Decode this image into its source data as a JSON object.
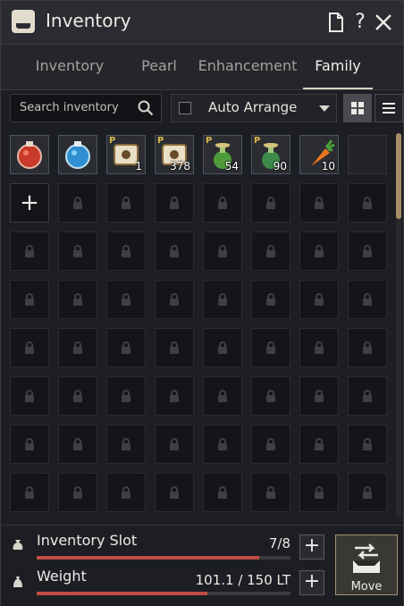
{
  "window": {
    "title": "Inventory",
    "title_icon": "inventory-chest-icon"
  },
  "titlebar_buttons": {
    "doc": "document-icon",
    "help": "?",
    "close": "✕"
  },
  "tabs": [
    {
      "label": "Inventory",
      "active": false
    },
    {
      "label": "Pearl",
      "active": false
    },
    {
      "label": "Enhancement",
      "active": false
    },
    {
      "label": "Family",
      "active": true
    }
  ],
  "toolbar": {
    "search_placeholder": "Search inventory",
    "search_icon": "search-icon",
    "auto_arrange_label": "Auto Arrange",
    "auto_arrange_checked": false
  },
  "items": [
    {
      "name": "red-potion",
      "count": ""
    },
    {
      "name": "blue-potion",
      "count": ""
    },
    {
      "name": "pearl-scroll-a",
      "count": "1",
      "pearl": "P"
    },
    {
      "name": "pearl-scroll-b",
      "count": "378",
      "pearl": "P"
    },
    {
      "name": "pearl-elixir-a",
      "count": "54",
      "pearl": "P"
    },
    {
      "name": "pearl-elixir-b",
      "count": "90",
      "pearl": "P"
    },
    {
      "name": "carrot",
      "count": "10"
    }
  ],
  "slots": {
    "total_rows": 7,
    "columns": 8,
    "unlocked": 8,
    "add_slot": "+"
  },
  "footer": {
    "slot_label": "Inventory Slot",
    "slot_value": "7/8",
    "slot_fraction": 0.875,
    "weight_label": "Weight",
    "weight_value": "101.1 / 150 LT",
    "weight_fraction": 0.674,
    "move_label": "Move",
    "plus": "+"
  },
  "colors": {
    "accent": "#c04d46",
    "move_border": "#a4946e",
    "pearl_badge": "#d9b84a"
  }
}
